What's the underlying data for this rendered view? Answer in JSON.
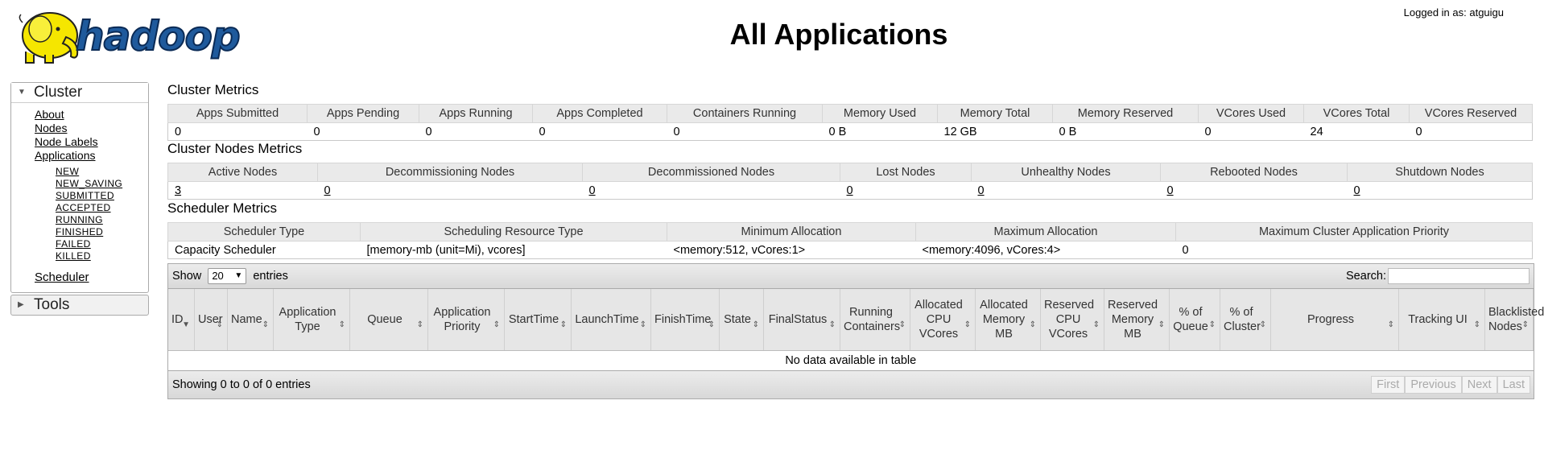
{
  "header": {
    "logo_text": "hadoop",
    "title": "All Applications",
    "logged_in": "Logged in as: atguigu"
  },
  "sidebar": {
    "cluster_label": "Cluster",
    "links": [
      "About",
      "Nodes",
      "Node Labels",
      "Applications"
    ],
    "app_states": [
      "NEW",
      "NEW_SAVING",
      "SUBMITTED",
      "ACCEPTED",
      "RUNNING",
      "FINISHED",
      "FAILED",
      "KILLED"
    ],
    "scheduler_label": "Scheduler",
    "tools_label": "Tools"
  },
  "cluster_metrics": {
    "title": "Cluster Metrics",
    "headers": [
      "Apps Submitted",
      "Apps Pending",
      "Apps Running",
      "Apps Completed",
      "Containers Running",
      "Memory Used",
      "Memory Total",
      "Memory Reserved",
      "VCores Used",
      "VCores Total",
      "VCores Reserved"
    ],
    "values": [
      "0",
      "0",
      "0",
      "0",
      "0",
      "0 B",
      "12 GB",
      "0 B",
      "0",
      "24",
      "0"
    ]
  },
  "cluster_nodes_metrics": {
    "title": "Cluster Nodes Metrics",
    "headers": [
      "Active Nodes",
      "Decommissioning Nodes",
      "Decommissioned Nodes",
      "Lost Nodes",
      "Unhealthy Nodes",
      "Rebooted Nodes",
      "Shutdown Nodes"
    ],
    "values": [
      "3",
      "0",
      "0",
      "0",
      "0",
      "0",
      "0"
    ]
  },
  "scheduler_metrics": {
    "title": "Scheduler Metrics",
    "headers": [
      "Scheduler Type",
      "Scheduling Resource Type",
      "Minimum Allocation",
      "Maximum Allocation",
      "Maximum Cluster Application Priority"
    ],
    "values": [
      "Capacity Scheduler",
      "[memory-mb (unit=Mi), vcores]",
      "<memory:512, vCores:1>",
      "<memory:4096, vCores:4>",
      "0"
    ]
  },
  "apps_table": {
    "show_label": "Show",
    "entries_label": "entries",
    "page_size": "20",
    "search_label": "Search:",
    "search_value": "",
    "columns": [
      "ID",
      "User",
      "Name",
      "Application Type",
      "Queue",
      "Application Priority",
      "StartTime",
      "LaunchTime",
      "FinishTime",
      "State",
      "FinalStatus",
      "Running Containers",
      "Allocated CPU VCores",
      "Allocated Memory MB",
      "Reserved CPU VCores",
      "Reserved Memory MB",
      "% of Queue",
      "% of Cluster",
      "Progress",
      "Tracking UI",
      "Blacklisted Nodes"
    ],
    "empty_message": "No data available in table",
    "info": "Showing 0 to 0 of 0 entries",
    "pager": [
      "First",
      "Previous",
      "Next",
      "Last"
    ]
  },
  "colors": {
    "header_bg": "#eaeaea",
    "logo_yellow": "#f5e600",
    "logo_blue": "#1f5a9c"
  },
  "icons": {
    "expanded": "triangle-down-icon",
    "collapsed": "triangle-right-icon",
    "sort": "sort-both-icon",
    "sort_asc": "sort-asc-icon"
  }
}
